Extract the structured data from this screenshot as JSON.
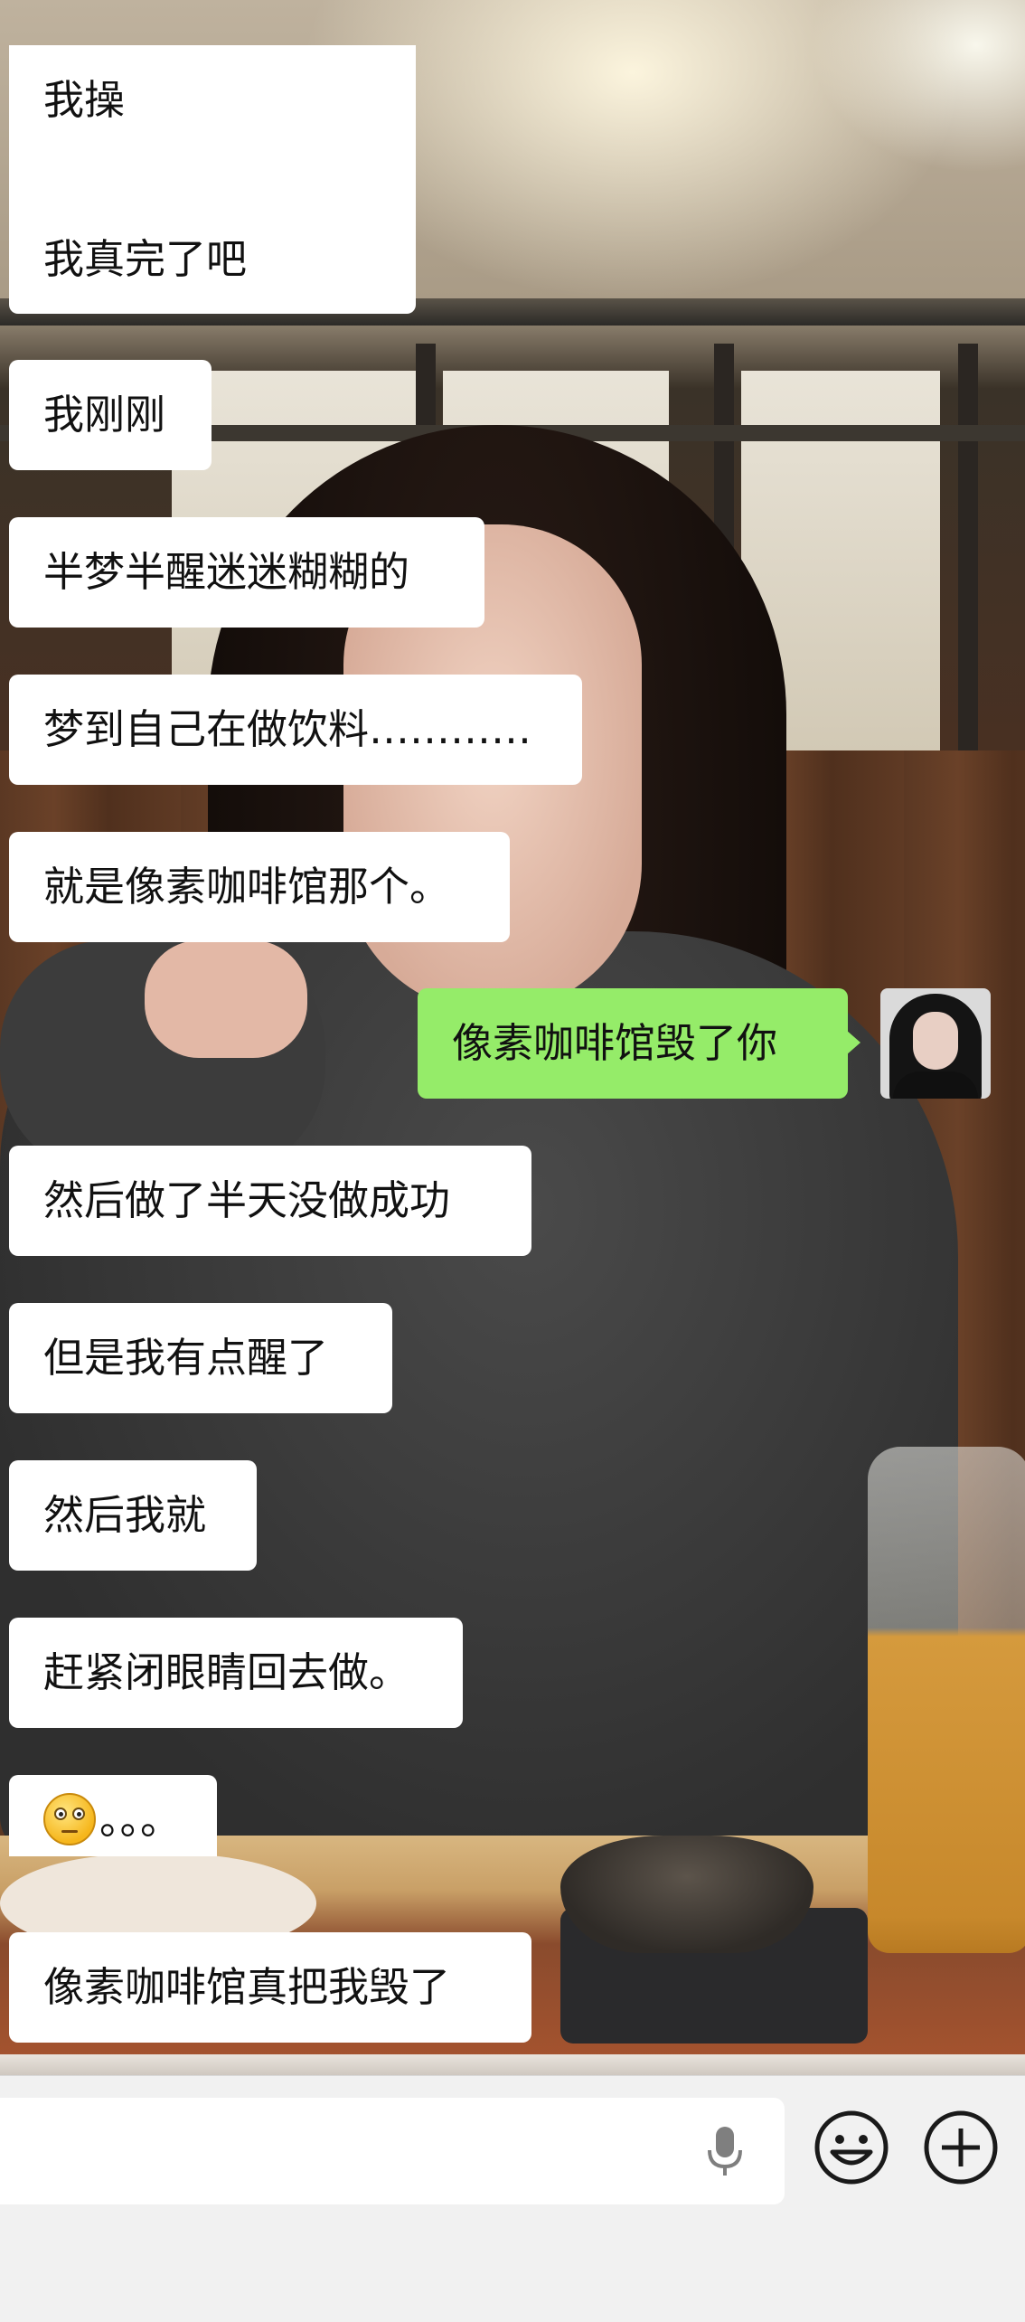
{
  "chat": {
    "messages": [
      {
        "side": "incoming",
        "text": "我操"
      },
      {
        "side": "incoming",
        "text": "我真完了吧"
      },
      {
        "side": "incoming",
        "text": "我刚刚"
      },
      {
        "side": "incoming",
        "text": "半梦半醒迷迷糊糊的"
      },
      {
        "side": "incoming",
        "text": "梦到自己在做饮料…………"
      },
      {
        "side": "incoming",
        "text": "就是像素咖啡馆那个。"
      },
      {
        "side": "outgoing",
        "text": "像素咖啡馆毁了你"
      },
      {
        "side": "incoming",
        "text": "然后做了半天没做成功"
      },
      {
        "side": "incoming",
        "text": "但是我有点醒了"
      },
      {
        "side": "incoming",
        "text": "然后我就"
      },
      {
        "side": "incoming",
        "text": "赶紧闭眼睛回去做。"
      },
      {
        "side": "incoming",
        "emoji": "flushed-face",
        "text": "。。。"
      },
      {
        "side": "incoming",
        "text": "像素咖啡馆真把我毁了"
      }
    ]
  },
  "input_bar": {
    "input_value": "",
    "icons": {
      "voice": "microphone-icon",
      "emoji": "smiley-icon",
      "more": "plus-circle-icon"
    }
  },
  "colors": {
    "incoming_bubble": "#ffffff",
    "outgoing_bubble": "#95ec69",
    "input_bar_bg": "#f1f1f1",
    "text": "#111111"
  }
}
